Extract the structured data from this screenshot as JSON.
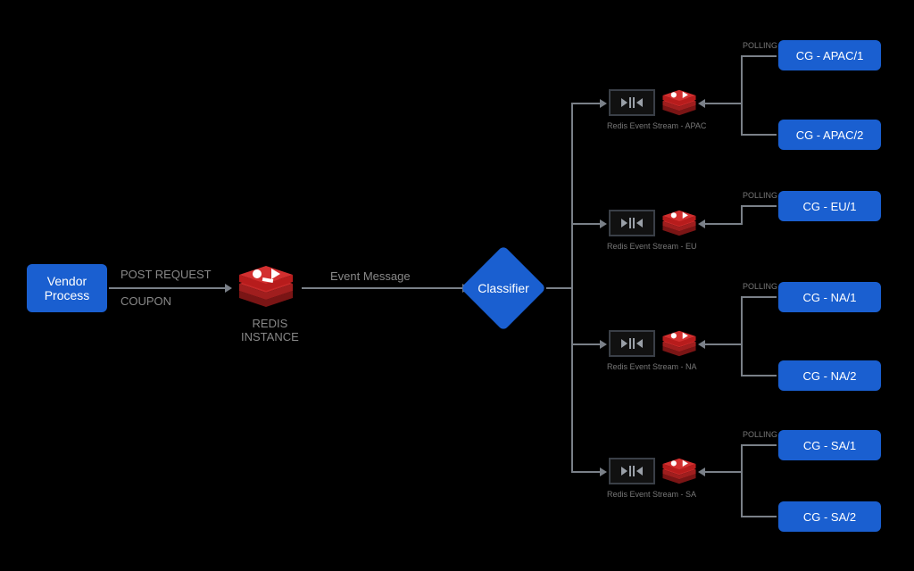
{
  "vendor": {
    "label": "Vendor\nProcess"
  },
  "edge1": {
    "top": "POST REQUEST",
    "bottom": "COUPON"
  },
  "redis_main": {
    "label": "REDIS\nINSTANCE"
  },
  "edge2": {
    "label": "Event Message"
  },
  "classifier": {
    "label": "Classifier"
  },
  "streams": [
    {
      "label": "Redis Event Stream - APAC",
      "polling": "POLLING"
    },
    {
      "label": "Redis Event Stream - EU",
      "polling": "POLLING"
    },
    {
      "label": "Redis Event Stream - NA",
      "polling": "POLLING"
    },
    {
      "label": "Redis Event Stream - SA",
      "polling": "POLLING"
    }
  ],
  "consumers": [
    {
      "label": "CG - APAC/1"
    },
    {
      "label": "CG - APAC/2"
    },
    {
      "label": "CG - EU/1"
    },
    {
      "label": "CG - NA/1"
    },
    {
      "label": "CG - NA/2"
    },
    {
      "label": "CG - SA/1"
    },
    {
      "label": "CG - SA/2"
    }
  ]
}
